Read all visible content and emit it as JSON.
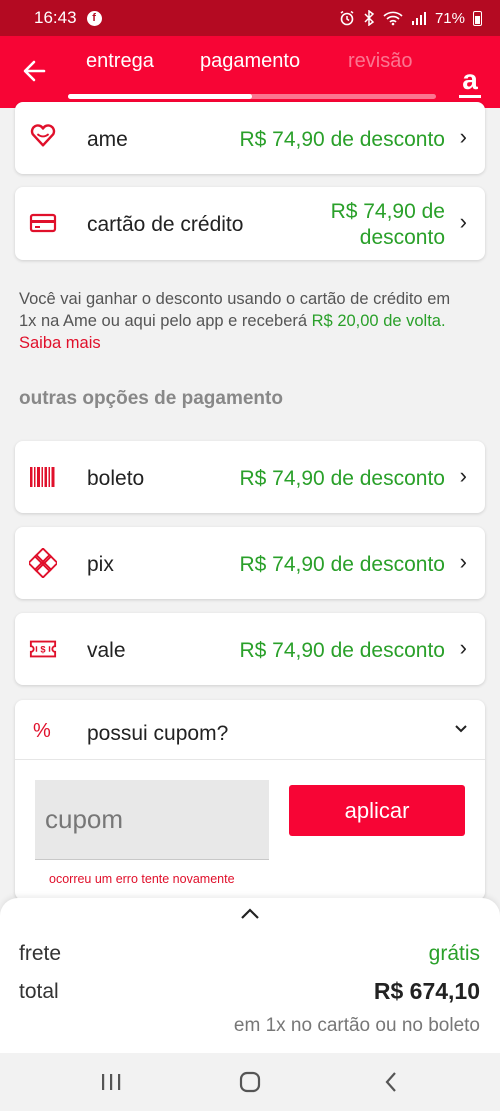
{
  "status_bar": {
    "time": "16:43",
    "fb_glyph": "f",
    "icons": [
      "alarm-icon",
      "bluetooth-icon",
      "wifi-icon",
      "signal-icon"
    ],
    "battery": "71%"
  },
  "header": {
    "tabs": [
      {
        "label": "entrega"
      },
      {
        "label": "pagamento"
      },
      {
        "label": "revisão"
      }
    ],
    "logo_glyph": "a",
    "progress_fraction": 0.5,
    "brand_color": "#f70535"
  },
  "payment_options": [
    {
      "label": "ame",
      "discount": "R$ 74,90 de desconto",
      "icon": "heart-icon"
    },
    {
      "label": "cartão de crédito",
      "discount": "R$ 74,90 de desconto",
      "icon": "credit-card-icon"
    }
  ],
  "info": {
    "text": "Você vai ganhar o desconto usando o cartão de crédito em 1x na Ame ou aqui pelo app e receberá ",
    "cashback": "R$ 20,00 de volta.",
    "link": "Saiba mais"
  },
  "other_options": {
    "title": "outras opções de pagamento",
    "items": [
      {
        "label": "boleto",
        "discount": "R$ 74,90 de desconto",
        "icon": "barcode-icon"
      },
      {
        "label": "pix",
        "discount": "R$ 74,90 de desconto",
        "icon": "pix-icon"
      },
      {
        "label": "vale",
        "discount": "R$ 74,90 de desconto",
        "icon": "voucher-icon"
      }
    ]
  },
  "coupon": {
    "title": "possui cupom?",
    "placeholder": "cupom",
    "apply_label": "aplicar",
    "error": "ocorreu um erro tente novamente"
  },
  "summary": {
    "frete_label": "frete",
    "frete_value": "grátis",
    "total_label": "total",
    "total_value": "R$ 674,10",
    "note": "em 1x no cartão ou no boleto"
  },
  "colors": {
    "accent": "#f70535",
    "status_bar": "#b40a22",
    "discount_green": "#2aa02a"
  }
}
